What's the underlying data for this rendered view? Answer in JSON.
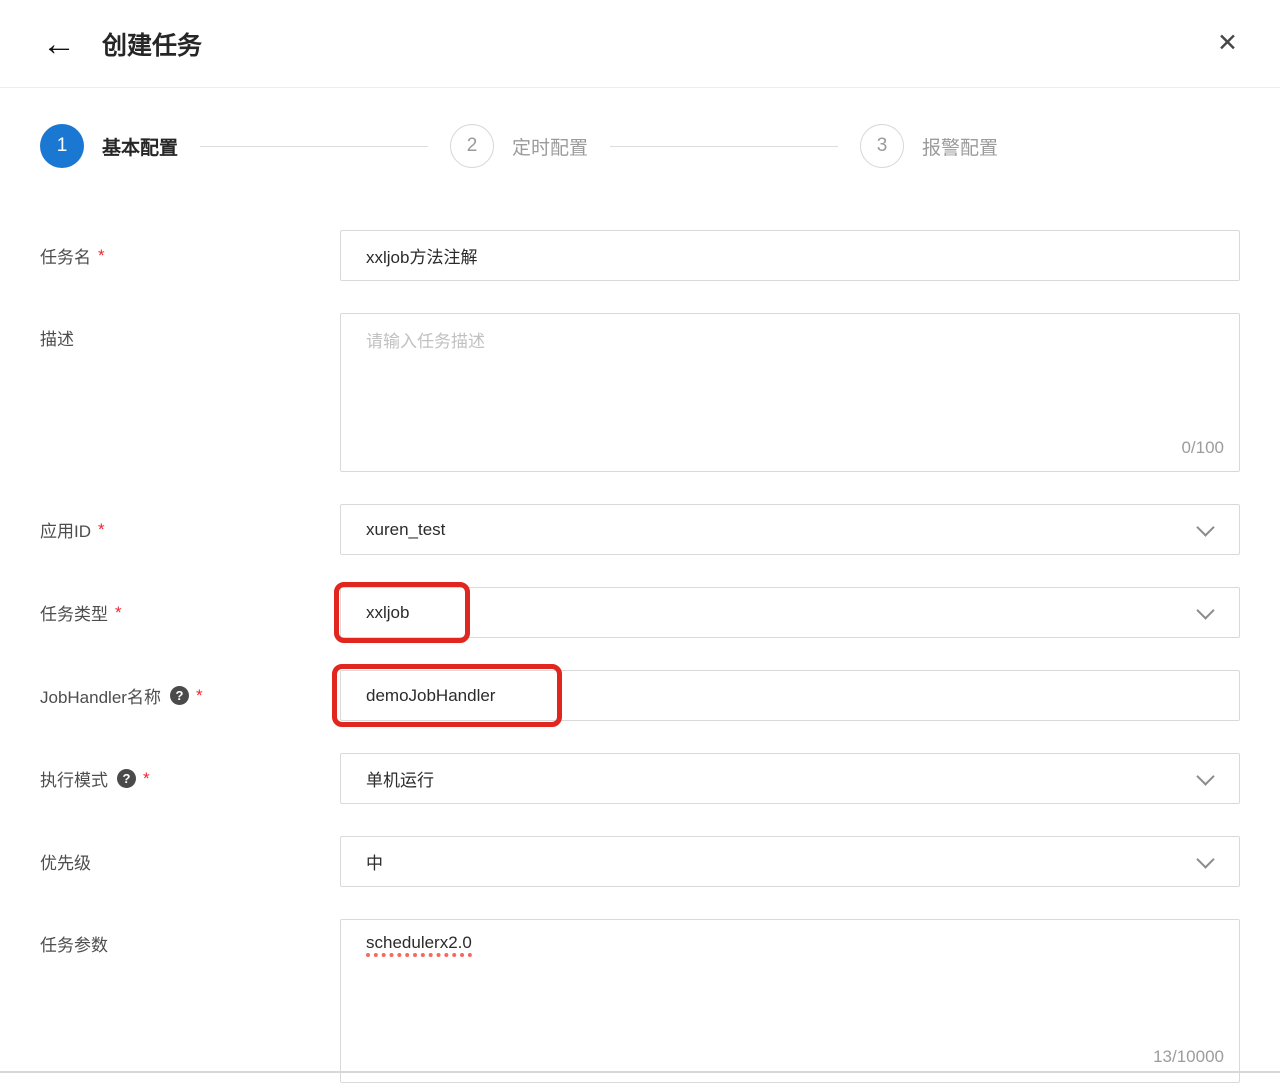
{
  "header": {
    "title": "创建任务",
    "back_icon": "←",
    "close_icon": "✕"
  },
  "steps": [
    {
      "number": "1",
      "label": "基本配置",
      "state": "active"
    },
    {
      "number": "2",
      "label": "定时配置",
      "state": "inactive"
    },
    {
      "number": "3",
      "label": "报警配置",
      "state": "inactive"
    }
  ],
  "form": {
    "required_mark": "*",
    "help_icon": "?",
    "task_name": {
      "label": "任务名",
      "value": "xxljob方法注解"
    },
    "description": {
      "label": "描述",
      "placeholder": "请输入任务描述",
      "counter": "0/100"
    },
    "app_id": {
      "label": "应用ID",
      "value": "xuren_test"
    },
    "task_type": {
      "label": "任务类型",
      "value": "xxljob"
    },
    "job_handler": {
      "label": "JobHandler名称",
      "value": "demoJobHandler"
    },
    "exec_mode": {
      "label": "执行模式",
      "value": "单机运行"
    },
    "priority": {
      "label": "优先级",
      "value": "中"
    },
    "task_params": {
      "label": "任务参数",
      "value": "schedulerx2.0",
      "counter": "13/10000"
    }
  },
  "colors": {
    "accent_blue": "#1a78d2",
    "annotation_red": "#e1251f",
    "required_red": "#f5222d"
  }
}
